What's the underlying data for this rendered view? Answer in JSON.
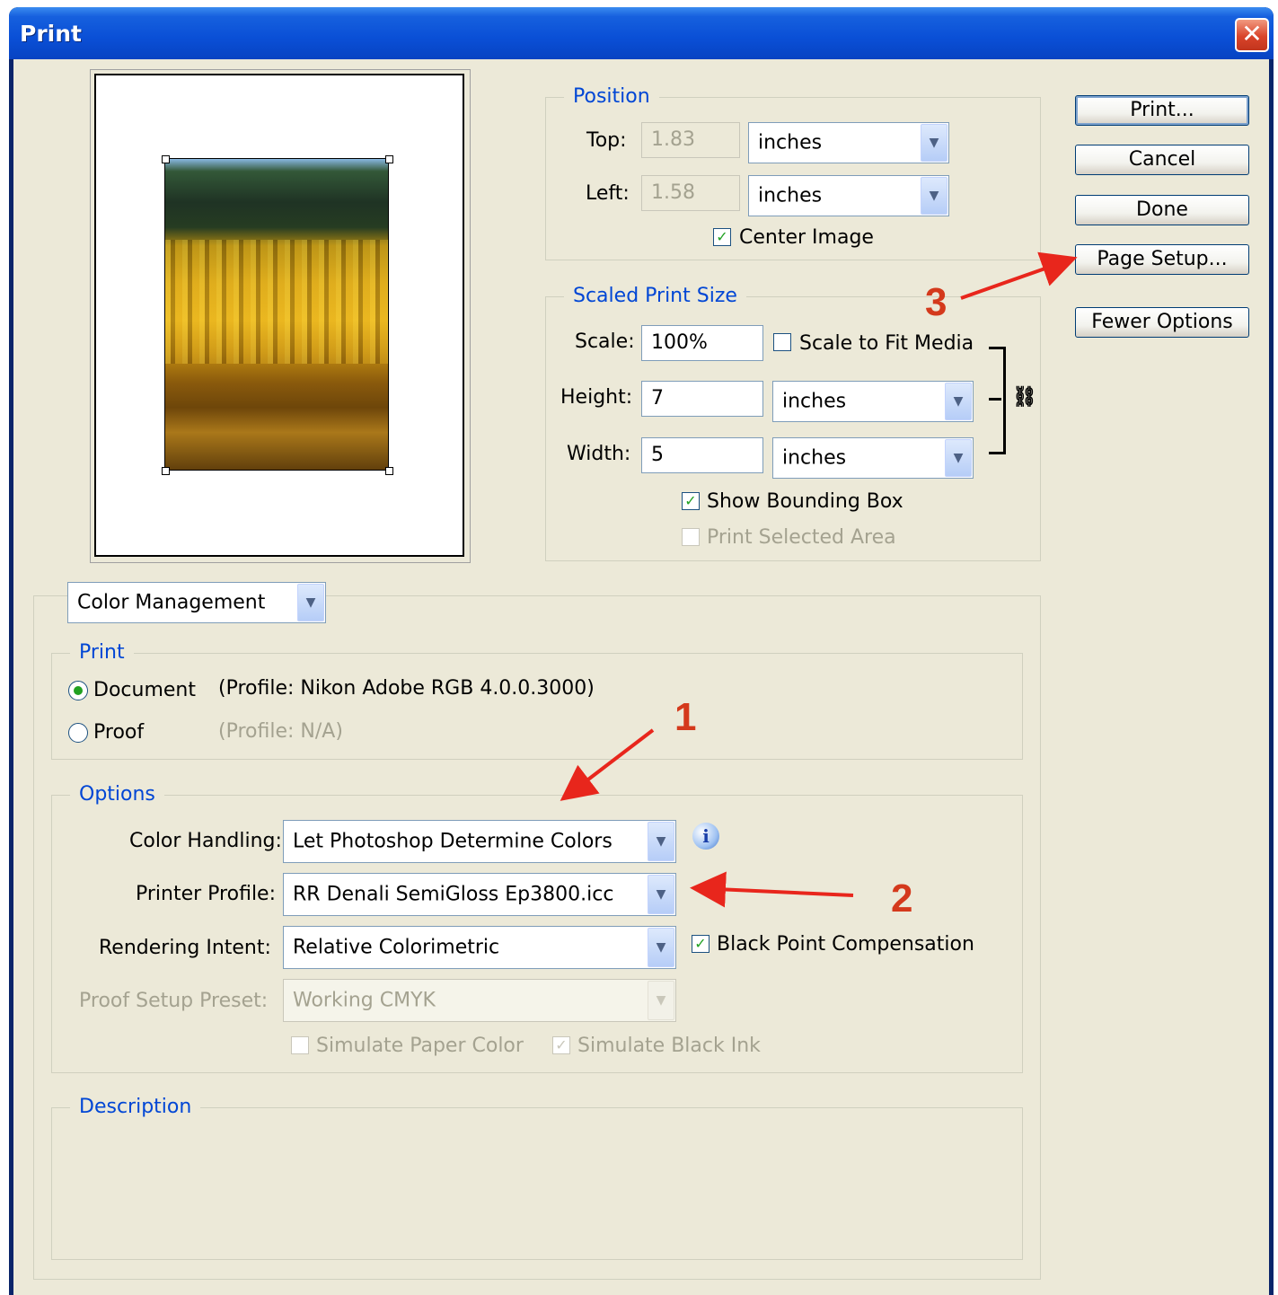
{
  "window": {
    "title": "Print"
  },
  "position": {
    "legend": "Position",
    "top_label": "Top:",
    "top_value": "1.83",
    "top_unit": "inches",
    "left_label": "Left:",
    "left_value": "1.58",
    "left_unit": "inches",
    "center_image_label": "Center Image",
    "center_image_checked": true
  },
  "scaled": {
    "legend": "Scaled Print Size",
    "scale_label": "Scale:",
    "scale_value": "100%",
    "fit_media_label": "Scale to Fit Media",
    "fit_media_checked": false,
    "height_label": "Height:",
    "height_value": "7",
    "height_unit": "inches",
    "width_label": "Width:",
    "width_value": "5",
    "width_unit": "inches",
    "bounding_label": "Show Bounding Box",
    "bounding_checked": true,
    "selected_area_label": "Print Selected Area",
    "selected_area_checked": false
  },
  "buttons": {
    "print": "Print...",
    "cancel": "Cancel",
    "done": "Done",
    "page_setup": "Page Setup...",
    "fewer_options": "Fewer Options"
  },
  "section_select": "Color Management",
  "print_group": {
    "legend": "Print",
    "document_label": "Document",
    "document_profile": "(Profile: Nikon Adobe RGB 4.0.0.3000)",
    "proof_label": "Proof",
    "proof_profile": "(Profile: N/A)",
    "selected": "Document"
  },
  "options": {
    "legend": "Options",
    "color_handling_label": "Color Handling:",
    "color_handling_value": "Let Photoshop Determine Colors",
    "printer_profile_label": "Printer Profile:",
    "printer_profile_value": "RR Denali SemiGloss Ep3800.icc",
    "rendering_intent_label": "Rendering Intent:",
    "rendering_intent_value": "Relative Colorimetric",
    "bpc_label": "Black Point Compensation",
    "bpc_checked": true,
    "proof_setup_label": "Proof Setup Preset:",
    "proof_setup_value": "Working CMYK",
    "simulate_paper_label": "Simulate Paper Color",
    "simulate_paper_checked": false,
    "simulate_ink_label": "Simulate Black Ink",
    "simulate_ink_checked": true
  },
  "description": {
    "legend": "Description"
  },
  "annotations": {
    "one": "1",
    "two": "2",
    "three": "3",
    "color": "#e8261c"
  },
  "icons": {
    "close": "close-icon",
    "info": "info-icon",
    "link": "chain-link-icon",
    "dropdown": "chevron-down-icon"
  }
}
